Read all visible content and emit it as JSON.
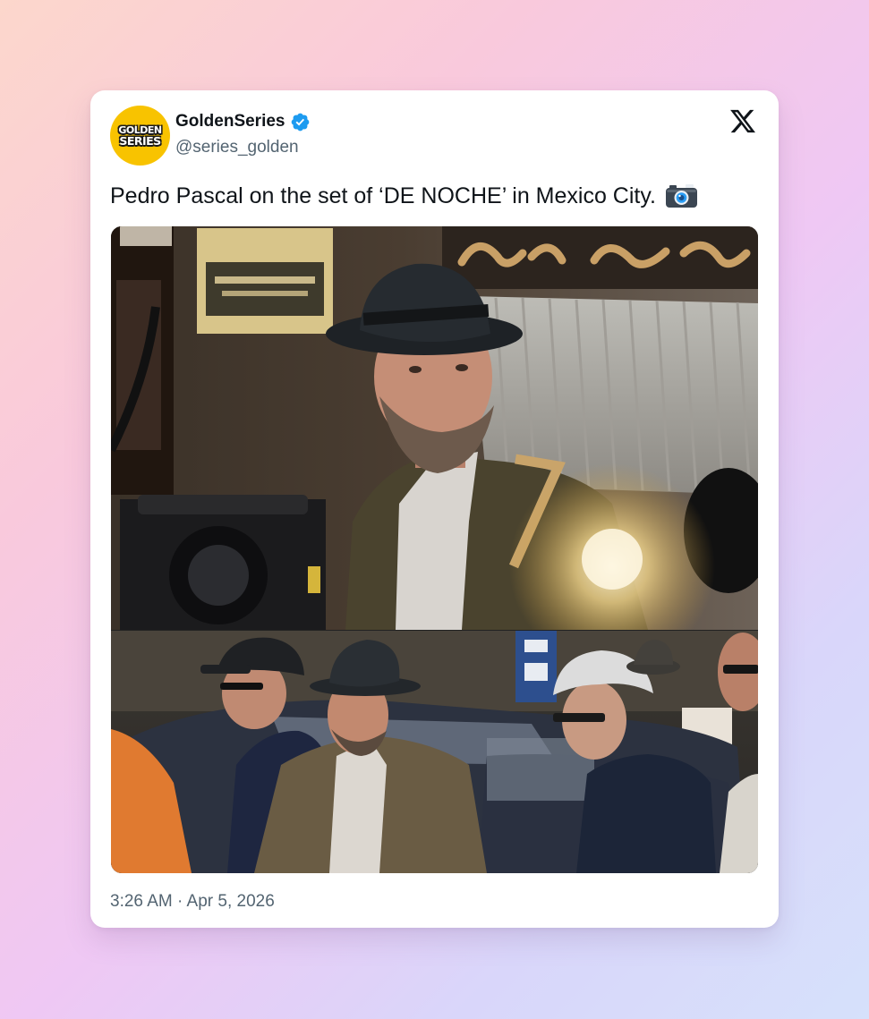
{
  "account": {
    "display_name": "GoldenSeries",
    "handle": "@series_golden",
    "verified": true,
    "avatar_text": [
      "GOLDEN",
      "SERIES"
    ]
  },
  "tweet": {
    "text": "Pedro Pascal on the set of ‘DE NOCHE’ in Mexico City.",
    "emoji": "camera-with-flash",
    "timestamp": "3:26 AM · Apr 5, 2026",
    "media_count": 2
  },
  "platform_icon": "x-logo-icon",
  "colors": {
    "verified_blue": "#1d9bf0",
    "avatar_yellow": "#f8c300",
    "text_primary": "#0f1419",
    "text_secondary": "#536471"
  }
}
